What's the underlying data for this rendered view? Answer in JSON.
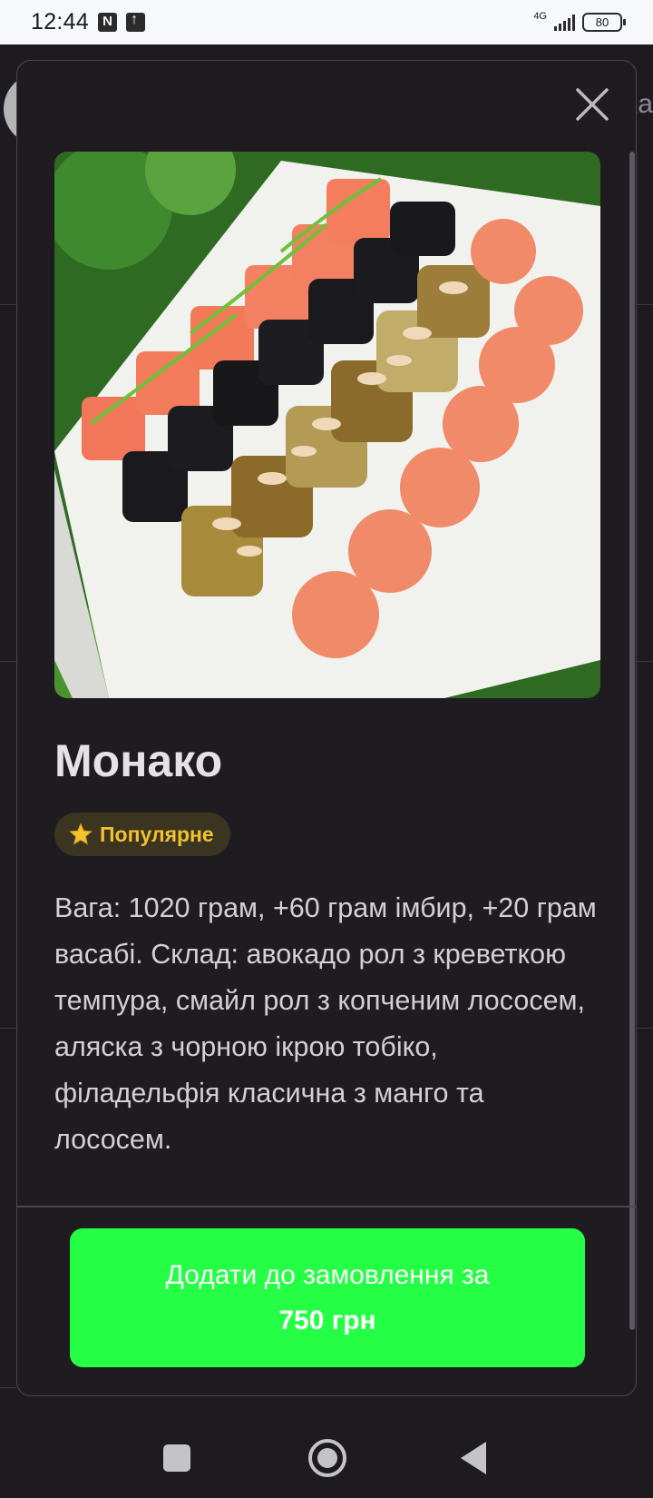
{
  "status_bar": {
    "time": "12:44",
    "network": "4G",
    "battery": "80"
  },
  "background": {
    "right_text": "Ka"
  },
  "product": {
    "title": "Монако",
    "badge": {
      "icon": "star-icon",
      "label": "Популярне"
    },
    "description": "Вага: 1020 грам, +60 грам імбир, +20 грам васабі. Склад: авокадо рол з креветкою темпура, смайл рол з копченим лососем, аляска з чорною ікрою тобіко, філадельфія класична з манго та лососем.",
    "add_button": {
      "label": "Додати до замовлення за",
      "price": "750 грн"
    }
  },
  "colors": {
    "modal_bg": "#1e1c21",
    "page_bg": "#1d1b20",
    "button_bg": "#24ff45",
    "badge_bg": "#3a3421",
    "badge_text": "#f2c12e"
  },
  "nav_bar": {
    "icons": [
      "recent-apps-icon",
      "home-icon",
      "back-icon"
    ]
  }
}
